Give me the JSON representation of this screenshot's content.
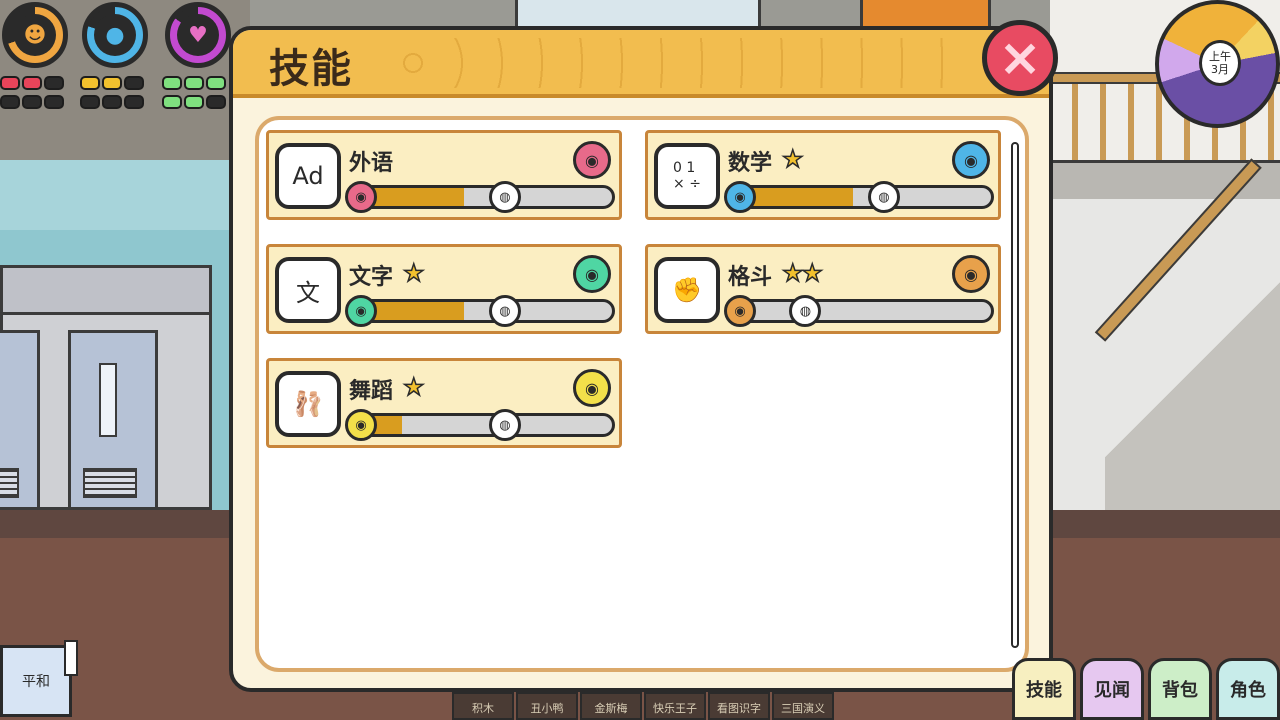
{
  "hud": {
    "stats": [
      {
        "icon": "gingerbread-icon",
        "color": "#f0a641"
      },
      {
        "icon": "blob-icon",
        "color": "#4fb5e7"
      },
      {
        "icon": "heart-icon",
        "color": "#c24ad0"
      }
    ],
    "clock": {
      "period": "上午",
      "month": "3月"
    }
  },
  "panel": {
    "title": "技能",
    "close_label": "×"
  },
  "skills": [
    {
      "name": "外语",
      "stars": "",
      "icon_text": "Ad",
      "badge_color": "#e86a8a",
      "start_color": "#e86a8a",
      "fill_percent": 42,
      "marker_percent": 58
    },
    {
      "name": "数学",
      "stars": "★",
      "icon_text": "0 1\n× ÷",
      "badge_color": "#4fb5e7",
      "start_color": "#4fb5e7",
      "fill_percent": 46,
      "marker_percent": 58
    },
    {
      "name": "文字",
      "stars": "★",
      "icon_text": "文",
      "badge_color": "#4fd6a3",
      "start_color": "#4fd6a3",
      "fill_percent": 42,
      "marker_percent": 58
    },
    {
      "name": "格斗",
      "stars": "★★",
      "icon_text": "✊",
      "badge_color": "#e8a14b",
      "start_color": "#e8a14b",
      "fill_percent": 0,
      "marker_percent": 28
    },
    {
      "name": "舞蹈",
      "stars": "★",
      "icon_text": "🩰",
      "badge_color": "#f3e04a",
      "start_color": "#f3e04a",
      "fill_percent": 18,
      "marker_percent": 58
    }
  ],
  "mood": {
    "label": "平和"
  },
  "shelf": [
    "积木",
    "丑小鸭",
    "金斯梅",
    "快乐王子",
    "看图识字",
    "三国演义"
  ],
  "menu": [
    {
      "label": "技能",
      "color": "#f7efc0"
    },
    {
      "label": "见闻",
      "color": "#e6c8f0"
    },
    {
      "label": "背包",
      "color": "#cdeec8"
    },
    {
      "label": "角色",
      "color": "#c8ecea"
    }
  ]
}
